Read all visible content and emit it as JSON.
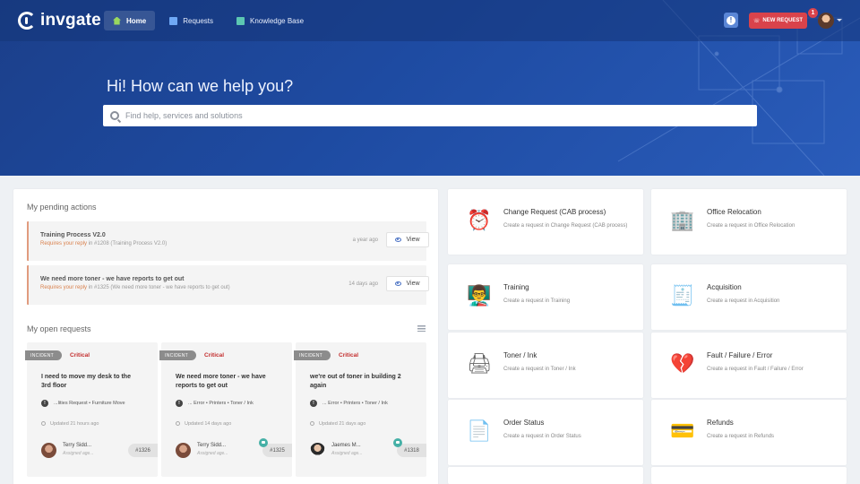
{
  "header": {
    "logo_text": "invgate",
    "nav": [
      {
        "label": "Home",
        "icon": "home-icon"
      },
      {
        "label": "Requests",
        "icon": "document-icon"
      },
      {
        "label": "Knowledge Base",
        "icon": "book-icon"
      }
    ],
    "info_label": "!",
    "new_request_label": "NEW REQUEST",
    "notification_count": "1"
  },
  "hero": {
    "title": "Hi! How can we help you?",
    "search_placeholder": "Find help, services and solutions"
  },
  "pending": {
    "title": "My pending actions",
    "items": [
      {
        "title": "Training Process V2.0",
        "reply_label": "Requires your reply",
        "reply_rest": " in #1208 (Training Process V2.0)",
        "time": "a year ago",
        "button": "View"
      },
      {
        "title": "We need more toner - we have reports to get out",
        "reply_label": "Requires your reply",
        "reply_rest": " in #1325 (We need more toner - we have reports to get out)",
        "time": "14 days ago",
        "button": "View"
      }
    ]
  },
  "open_requests": {
    "title": "My open requests",
    "items": [
      {
        "tag": "INCIDENT",
        "priority": "Critical",
        "title": "I need to move my desk to the 3rd floor",
        "crumbs": "...lities Request  •  Furniture Move",
        "updated": "Updated 21 hours ago",
        "assignee": "Terry Sidd...",
        "assigned": "Assigned age...",
        "number": "#1326"
      },
      {
        "tag": "INCIDENT",
        "priority": "Critical",
        "title": "We need more toner - we have reports to get out",
        "crumbs": "... Error  •  Printers  •  Toner / Ink",
        "updated": "Updated 14 days ago",
        "assignee": "Terry Sidd...",
        "assigned": "Assigned age...",
        "number": "#1325"
      },
      {
        "tag": "INCIDENT",
        "priority": "Critical",
        "title": "we're out of toner in building 2 again",
        "crumbs": "... Error  •  Printers  •  Toner / Ink",
        "updated": "Updated 21 days ago",
        "assignee": "Jaemes M...",
        "assigned": "Assigned age...",
        "number": "#1318"
      }
    ]
  },
  "services": [
    {
      "title": "Change Request (CAB process)",
      "desc": "Create a request in Change Request (CAB process)",
      "icon": "alarm-clock-icon"
    },
    {
      "title": "Office Relocation",
      "desc": "Create a request in Office Relocation",
      "icon": "building-icon"
    },
    {
      "title": "Training",
      "desc": "Create a request in Training",
      "icon": "presentation-icon"
    },
    {
      "title": "Acquisition",
      "desc": "Create a request in Acquisition",
      "icon": "cash-register-icon"
    },
    {
      "title": "Toner / Ink",
      "desc": "Create a request in Toner / Ink",
      "icon": "printer-icon"
    },
    {
      "title": "Fault / Failure / Error",
      "desc": "Create a request in Fault / Failure / Error",
      "icon": "broken-heart-icon"
    },
    {
      "title": "Order Status",
      "desc": "Create a request in Order Status",
      "icon": "document-plus-icon"
    },
    {
      "title": "Refunds",
      "desc": "Create a request in Refunds",
      "icon": "credit-card-icon"
    }
  ],
  "colors": {
    "hero_blue": "#1e4ba2",
    "accent_red": "#d9434b",
    "reply_orange": "#d9804c",
    "critical_red": "#c32c2c"
  }
}
